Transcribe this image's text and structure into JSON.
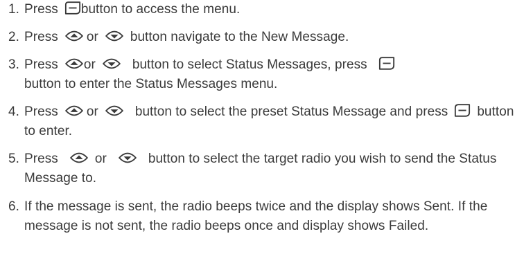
{
  "steps": [
    {
      "number": "1.",
      "t1": "Press",
      "t2": "button to access the menu.",
      "icon1": "menu-ok-button-icon"
    },
    {
      "number": "2.",
      "t1": "Press",
      "t2": "or",
      "t3": "button navigate to the New Message.",
      "icon1": "up-arrow-button-icon",
      "icon2": "down-arrow-button-icon"
    },
    {
      "number": "3.",
      "t1": "Press",
      "t2": "or",
      "t3": "button to select Status Messages, press",
      "t4": "button to enter the Status Messages menu.",
      "icon1": "up-arrow-button-icon",
      "icon2": "down-arrow-button-icon",
      "icon3": "menu-ok-button-icon"
    },
    {
      "number": "4.",
      "t1": "Press",
      "t2": "or",
      "t3": "button to select the preset Status Message and press",
      "t4": "button to enter.",
      "icon1": "up-arrow-button-icon",
      "icon2": "down-arrow-button-icon",
      "icon3": "back-button-icon"
    },
    {
      "number": "5.",
      "t1": "Press",
      "t2": "or",
      "t3": "button to select the target radio you wish to send the Status Message to.",
      "icon1": "up-arrow-button-icon",
      "icon2": "down-arrow-button-icon"
    },
    {
      "number": "6.",
      "text": "If the message is sent, the radio beeps twice and the display shows Sent. If the message is not sent, the radio beeps once and display shows Failed."
    }
  ]
}
